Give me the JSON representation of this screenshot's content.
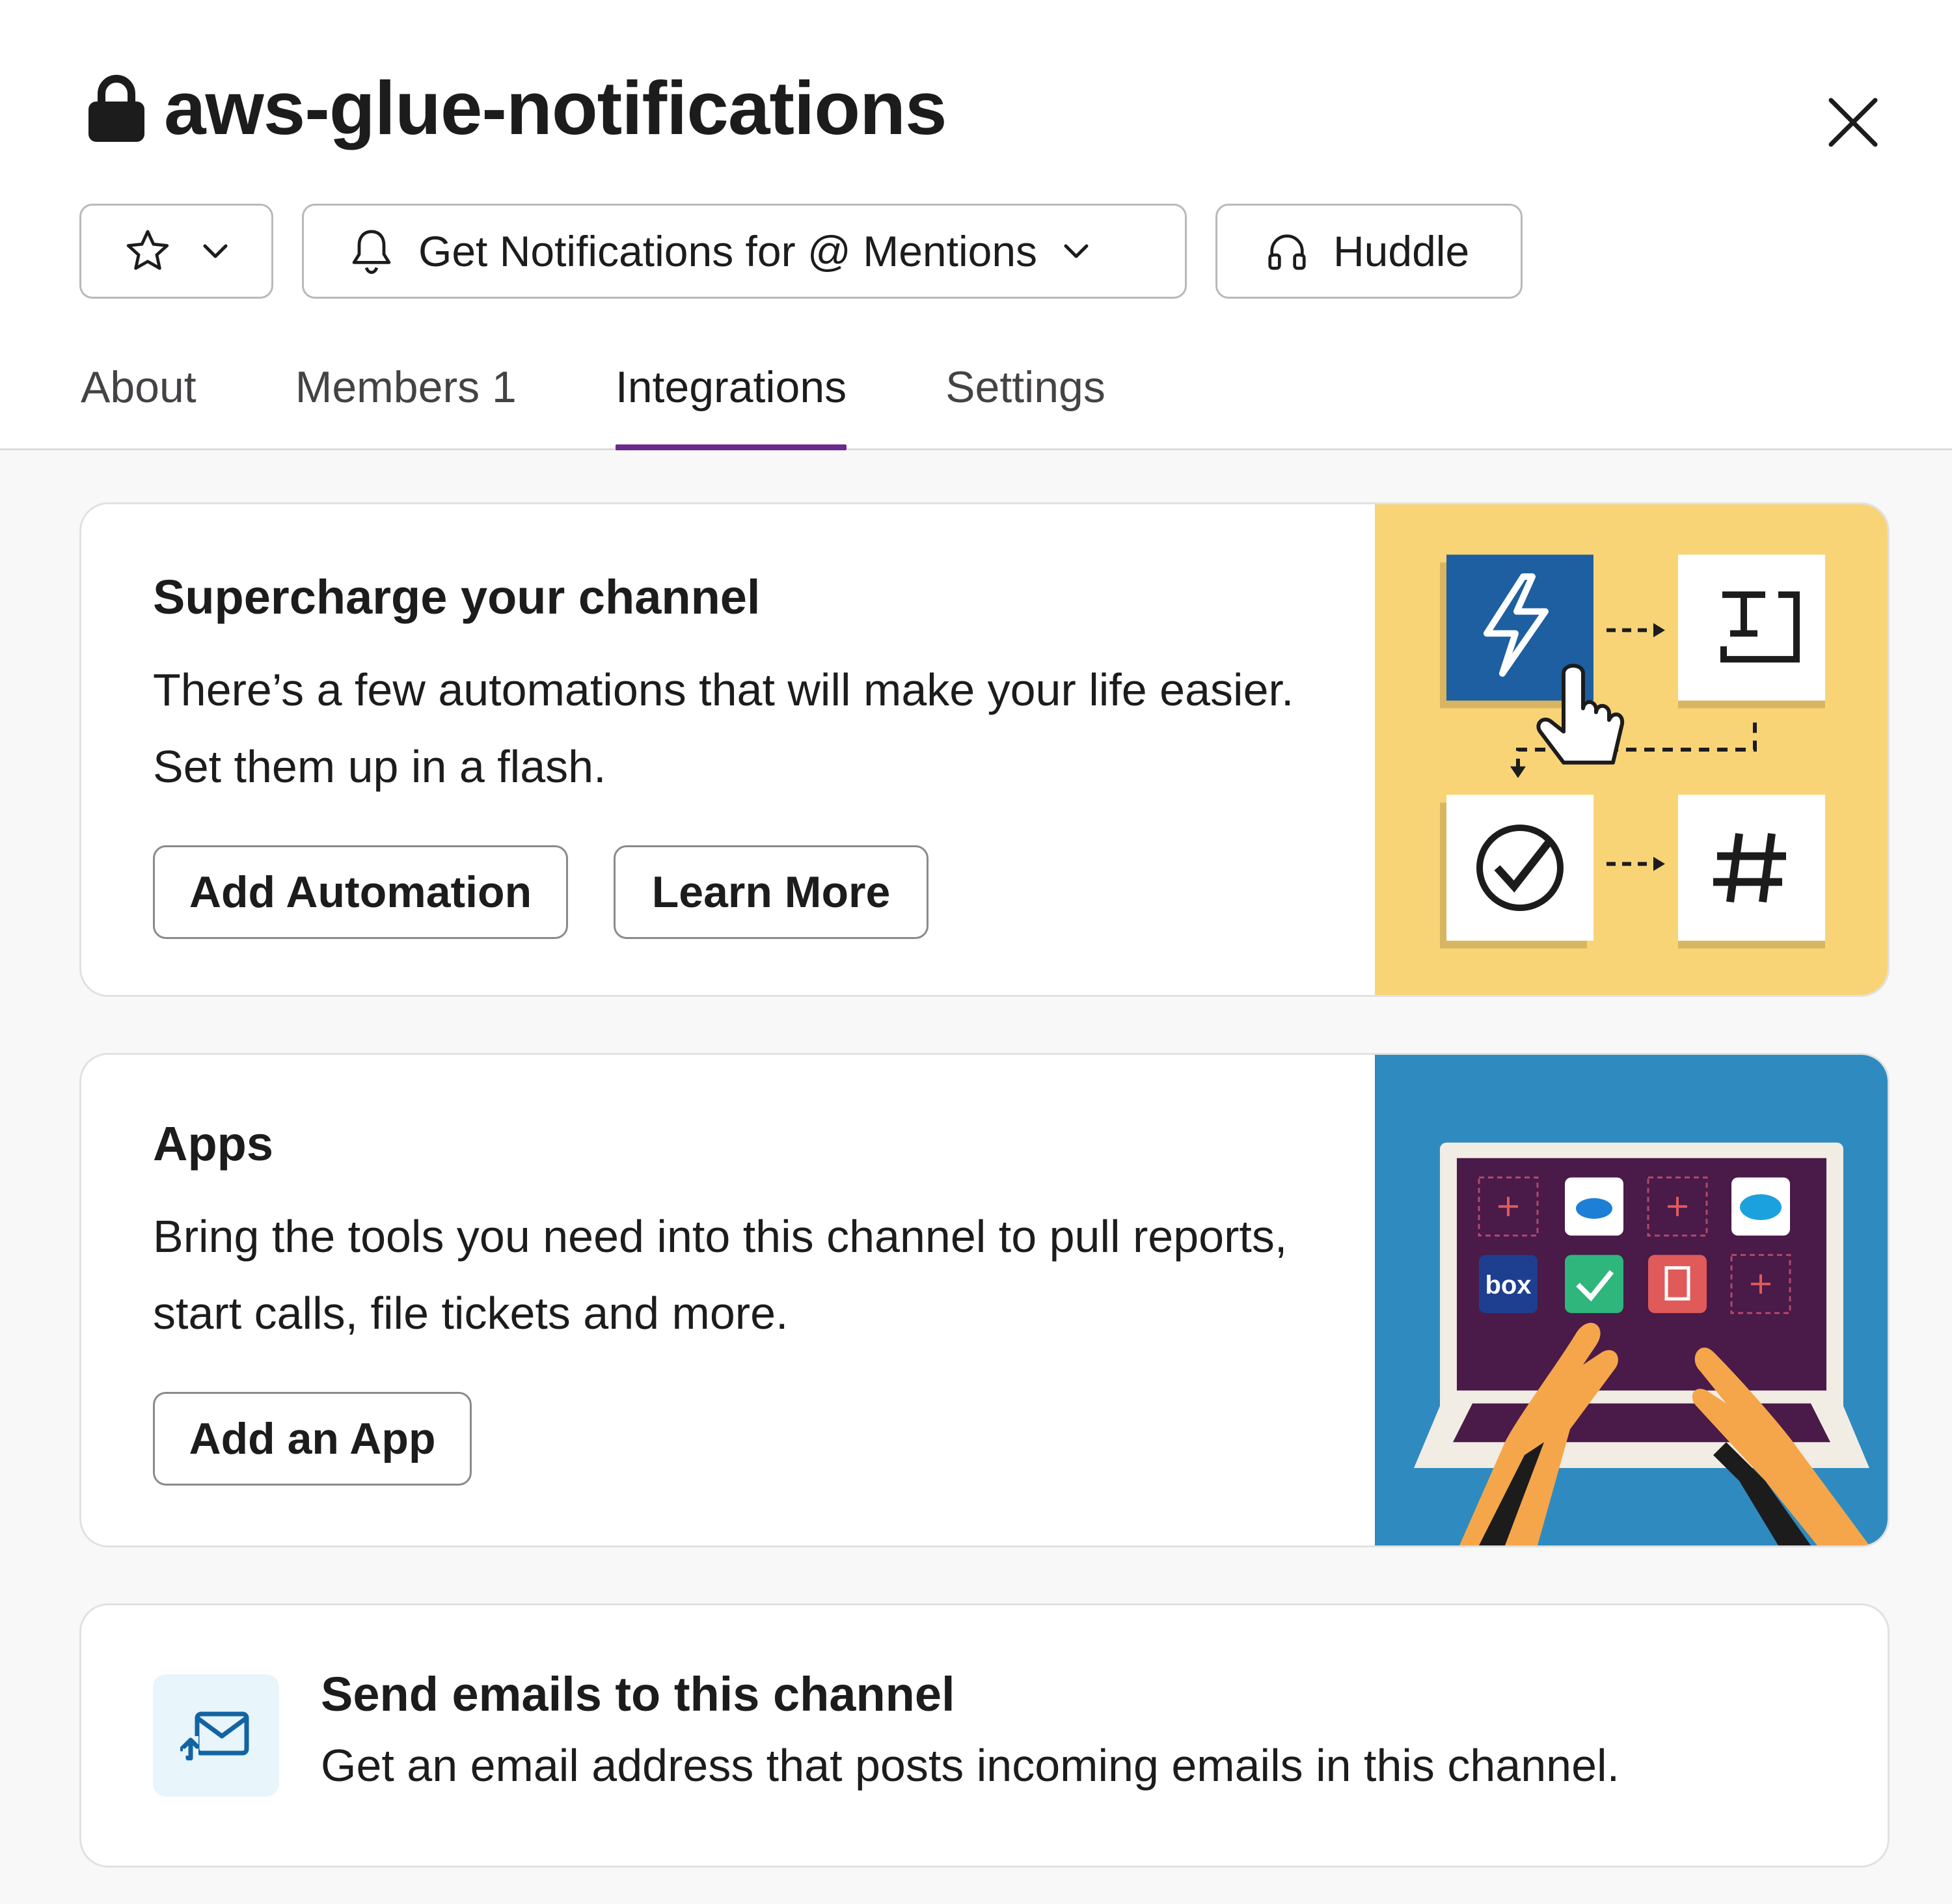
{
  "header": {
    "title": "aws-glue-notifications",
    "notifications_label": "Get Notifications for @ Mentions",
    "huddle_label": "Huddle"
  },
  "tabs": [
    {
      "label": "About"
    },
    {
      "label": "Members 1"
    },
    {
      "label": "Integrations"
    },
    {
      "label": "Settings"
    }
  ],
  "active_tab": "Integrations",
  "cards": {
    "automation": {
      "heading": "Supercharge your channel",
      "description": "There’s a few automations that will make your life easier. Set them up in a flash.",
      "primary_button": "Add Automation",
      "secondary_button": "Learn More",
      "illustration_bg": "#f9d477"
    },
    "apps": {
      "heading": "Apps",
      "description": "Bring the tools you need into this channel to pull reports, start calls, file tickets and more.",
      "button": "Add an App",
      "illustration_bg": "#2f8bbf",
      "illustration_app_label": "box"
    },
    "email": {
      "heading": "Send emails to this channel",
      "description": "Get an email address that posts incoming emails in this channel."
    }
  },
  "colors": {
    "accent": "#6b2a8c",
    "page_bg": "#f8f8f8",
    "text": "#1d1c1d"
  },
  "icons": [
    "lock-icon",
    "close-icon",
    "star-icon",
    "chevron-down-icon",
    "bell-icon",
    "headphones-icon",
    "email-forward-icon"
  ]
}
